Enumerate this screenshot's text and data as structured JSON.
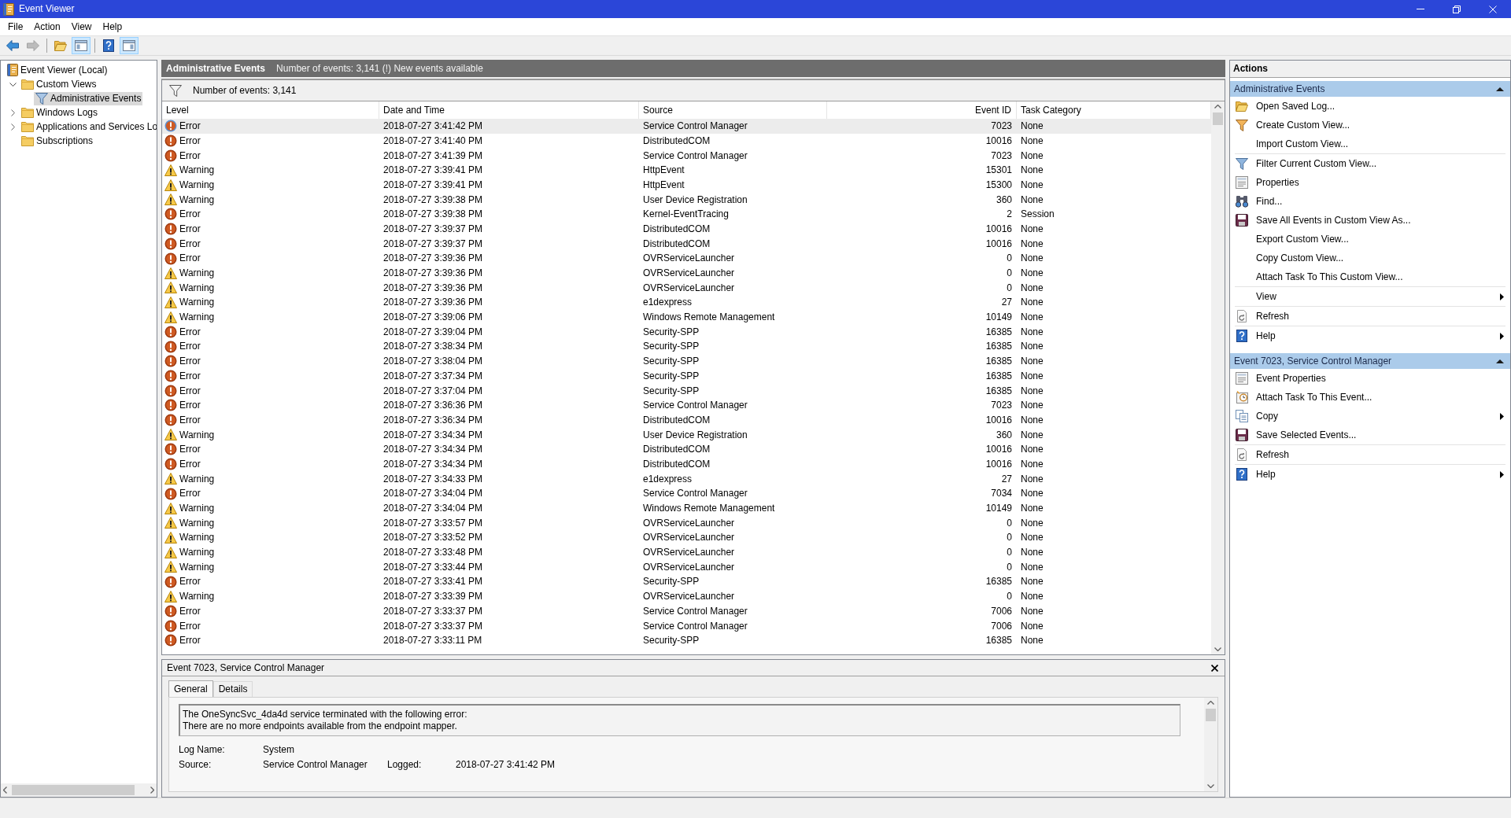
{
  "window": {
    "title": "Event Viewer"
  },
  "menu": [
    "File",
    "Action",
    "View",
    "Help"
  ],
  "toolbar": [
    [
      {
        "disabled": false,
        "pressed": false
      },
      {
        "disabled": true,
        "pressed": false
      }
    ],
    [
      {
        "disabled": false,
        "pressed": false
      },
      {
        "disabled": false,
        "pressed": true
      }
    ],
    [
      {
        "disabled": false,
        "pressed": false
      },
      {
        "disabled": false,
        "pressed": true
      }
    ]
  ],
  "tree": [
    {
      "label": "Event Viewer (Local)",
      "kind": "console",
      "selected": false,
      "children": [
        {
          "label": "Custom Views",
          "kind": "folder",
          "expanded": true,
          "selected": false,
          "children": [
            {
              "label": "Administrative Events",
              "kind": "view",
              "selected": true
            }
          ]
        },
        {
          "label": "Windows Logs",
          "kind": "folder",
          "expanded": false,
          "selected": false
        },
        {
          "label": "Applications and Services Lo",
          "kind": "folder",
          "expanded": false,
          "selected": false
        },
        {
          "label": "Subscriptions",
          "kind": "folder",
          "selected": false
        }
      ]
    }
  ],
  "view": {
    "title": "Administrative Events",
    "summary": "Number of events: 3,141 (!) New events available",
    "filter": "Number of events: 3,141"
  },
  "table": {
    "columns": [
      "Level",
      "Date and Time",
      "Source",
      "Event ID",
      "Task Category"
    ],
    "rows": [
      {
        "kind": "error",
        "level": "Error",
        "date": "2018-07-27 3:41:42 PM",
        "source": "Service Control Manager",
        "event_id": "7023",
        "task_category": "None",
        "selected": true
      },
      {
        "kind": "error",
        "level": "Error",
        "date": "2018-07-27 3:41:40 PM",
        "source": "DistributedCOM",
        "event_id": "10016",
        "task_category": "None",
        "selected": false
      },
      {
        "kind": "error",
        "level": "Error",
        "date": "2018-07-27 3:41:39 PM",
        "source": "Service Control Manager",
        "event_id": "7023",
        "task_category": "None",
        "selected": false
      },
      {
        "kind": "warning",
        "level": "Warning",
        "date": "2018-07-27 3:39:41 PM",
        "source": "HttpEvent",
        "event_id": "15301",
        "task_category": "None",
        "selected": false
      },
      {
        "kind": "warning",
        "level": "Warning",
        "date": "2018-07-27 3:39:41 PM",
        "source": "HttpEvent",
        "event_id": "15300",
        "task_category": "None",
        "selected": false
      },
      {
        "kind": "warning",
        "level": "Warning",
        "date": "2018-07-27 3:39:38 PM",
        "source": "User Device Registration",
        "event_id": "360",
        "task_category": "None",
        "selected": false
      },
      {
        "kind": "error",
        "level": "Error",
        "date": "2018-07-27 3:39:38 PM",
        "source": "Kernel-EventTracing",
        "event_id": "2",
        "task_category": "Session",
        "selected": false
      },
      {
        "kind": "error",
        "level": "Error",
        "date": "2018-07-27 3:39:37 PM",
        "source": "DistributedCOM",
        "event_id": "10016",
        "task_category": "None",
        "selected": false
      },
      {
        "kind": "error",
        "level": "Error",
        "date": "2018-07-27 3:39:37 PM",
        "source": "DistributedCOM",
        "event_id": "10016",
        "task_category": "None",
        "selected": false
      },
      {
        "kind": "error",
        "level": "Error",
        "date": "2018-07-27 3:39:36 PM",
        "source": "OVRServiceLauncher",
        "event_id": "0",
        "task_category": "None",
        "selected": false
      },
      {
        "kind": "warning",
        "level": "Warning",
        "date": "2018-07-27 3:39:36 PM",
        "source": "OVRServiceLauncher",
        "event_id": "0",
        "task_category": "None",
        "selected": false
      },
      {
        "kind": "warning",
        "level": "Warning",
        "date": "2018-07-27 3:39:36 PM",
        "source": "OVRServiceLauncher",
        "event_id": "0",
        "task_category": "None",
        "selected": false
      },
      {
        "kind": "warning",
        "level": "Warning",
        "date": "2018-07-27 3:39:36 PM",
        "source": "e1dexpress",
        "event_id": "27",
        "task_category": "None",
        "selected": false
      },
      {
        "kind": "warning",
        "level": "Warning",
        "date": "2018-07-27 3:39:06 PM",
        "source": "Windows Remote Management",
        "event_id": "10149",
        "task_category": "None",
        "selected": false
      },
      {
        "kind": "error",
        "level": "Error",
        "date": "2018-07-27 3:39:04 PM",
        "source": "Security-SPP",
        "event_id": "16385",
        "task_category": "None",
        "selected": false
      },
      {
        "kind": "error",
        "level": "Error",
        "date": "2018-07-27 3:38:34 PM",
        "source": "Security-SPP",
        "event_id": "16385",
        "task_category": "None",
        "selected": false
      },
      {
        "kind": "error",
        "level": "Error",
        "date": "2018-07-27 3:38:04 PM",
        "source": "Security-SPP",
        "event_id": "16385",
        "task_category": "None",
        "selected": false
      },
      {
        "kind": "error",
        "level": "Error",
        "date": "2018-07-27 3:37:34 PM",
        "source": "Security-SPP",
        "event_id": "16385",
        "task_category": "None",
        "selected": false
      },
      {
        "kind": "error",
        "level": "Error",
        "date": "2018-07-27 3:37:04 PM",
        "source": "Security-SPP",
        "event_id": "16385",
        "task_category": "None",
        "selected": false
      },
      {
        "kind": "error",
        "level": "Error",
        "date": "2018-07-27 3:36:36 PM",
        "source": "Service Control Manager",
        "event_id": "7023",
        "task_category": "None",
        "selected": false
      },
      {
        "kind": "error",
        "level": "Error",
        "date": "2018-07-27 3:36:34 PM",
        "source": "DistributedCOM",
        "event_id": "10016",
        "task_category": "None",
        "selected": false
      },
      {
        "kind": "warning",
        "level": "Warning",
        "date": "2018-07-27 3:34:34 PM",
        "source": "User Device Registration",
        "event_id": "360",
        "task_category": "None",
        "selected": false
      },
      {
        "kind": "error",
        "level": "Error",
        "date": "2018-07-27 3:34:34 PM",
        "source": "DistributedCOM",
        "event_id": "10016",
        "task_category": "None",
        "selected": false
      },
      {
        "kind": "error",
        "level": "Error",
        "date": "2018-07-27 3:34:34 PM",
        "source": "DistributedCOM",
        "event_id": "10016",
        "task_category": "None",
        "selected": false
      },
      {
        "kind": "warning",
        "level": "Warning",
        "date": "2018-07-27 3:34:33 PM",
        "source": "e1dexpress",
        "event_id": "27",
        "task_category": "None",
        "selected": false
      },
      {
        "kind": "error",
        "level": "Error",
        "date": "2018-07-27 3:34:04 PM",
        "source": "Service Control Manager",
        "event_id": "7034",
        "task_category": "None",
        "selected": false
      },
      {
        "kind": "warning",
        "level": "Warning",
        "date": "2018-07-27 3:34:04 PM",
        "source": "Windows Remote Management",
        "event_id": "10149",
        "task_category": "None",
        "selected": false
      },
      {
        "kind": "warning",
        "level": "Warning",
        "date": "2018-07-27 3:33:57 PM",
        "source": "OVRServiceLauncher",
        "event_id": "0",
        "task_category": "None",
        "selected": false
      },
      {
        "kind": "warning",
        "level": "Warning",
        "date": "2018-07-27 3:33:52 PM",
        "source": "OVRServiceLauncher",
        "event_id": "0",
        "task_category": "None",
        "selected": false
      },
      {
        "kind": "warning",
        "level": "Warning",
        "date": "2018-07-27 3:33:48 PM",
        "source": "OVRServiceLauncher",
        "event_id": "0",
        "task_category": "None",
        "selected": false
      },
      {
        "kind": "warning",
        "level": "Warning",
        "date": "2018-07-27 3:33:44 PM",
        "source": "OVRServiceLauncher",
        "event_id": "0",
        "task_category": "None",
        "selected": false
      },
      {
        "kind": "error",
        "level": "Error",
        "date": "2018-07-27 3:33:41 PM",
        "source": "Security-SPP",
        "event_id": "16385",
        "task_category": "None",
        "selected": false
      },
      {
        "kind": "warning",
        "level": "Warning",
        "date": "2018-07-27 3:33:39 PM",
        "source": "OVRServiceLauncher",
        "event_id": "0",
        "task_category": "None",
        "selected": false
      },
      {
        "kind": "error",
        "level": "Error",
        "date": "2018-07-27 3:33:37 PM",
        "source": "Service Control Manager",
        "event_id": "7006",
        "task_category": "None",
        "selected": false
      },
      {
        "kind": "error",
        "level": "Error",
        "date": "2018-07-27 3:33:37 PM",
        "source": "Service Control Manager",
        "event_id": "7006",
        "task_category": "None",
        "selected": false
      },
      {
        "kind": "error",
        "level": "Error",
        "date": "2018-07-27 3:33:11 PM",
        "source": "Security-SPP",
        "event_id": "16385",
        "task_category": "None",
        "selected": false
      }
    ]
  },
  "details": {
    "title": "Event 7023, Service Control Manager",
    "tabs": [
      {
        "label": "General",
        "selected": true
      },
      {
        "label": "Details",
        "selected": false
      }
    ],
    "message": "The OneSyncSvc_4da4d service terminated with the following error:\nThere are no more endpoints available from the endpoint mapper.",
    "fields": [
      [
        {
          "label": "Log Name:",
          "value": "System"
        }
      ],
      [
        {
          "label": "Source:",
          "value": "Service Control Manager"
        },
        {
          "label": "Logged:",
          "value": "2018-07-27 3:41:42 PM"
        }
      ]
    ]
  },
  "actions": {
    "title": "Actions",
    "sections": [
      {
        "title": "Administrative Events",
        "expanded": true,
        "groups": [
          [
            {
              "label": "Open Saved Log...",
              "submenu": false
            },
            {
              "label": "Create Custom View...",
              "submenu": false
            },
            {
              "label": "Import Custom View...",
              "submenu": false
            }
          ],
          [
            {
              "label": "Filter Current Custom View...",
              "submenu": false
            },
            {
              "label": "Properties",
              "submenu": false
            },
            {
              "label": "Find...",
              "submenu": false
            },
            {
              "label": "Save All Events in Custom View As...",
              "submenu": false
            },
            {
              "label": "Export Custom View...",
              "submenu": false
            },
            {
              "label": "Copy Custom View...",
              "submenu": false
            },
            {
              "label": "Attach Task To This Custom View...",
              "submenu": false
            }
          ],
          [
            {
              "label": "View",
              "submenu": true
            }
          ],
          [
            {
              "label": "Refresh",
              "submenu": false
            }
          ],
          [
            {
              "label": "Help",
              "submenu": true
            }
          ]
        ]
      },
      {
        "title": "Event 7023, Service Control Manager",
        "expanded": true,
        "groups": [
          [
            {
              "label": "Event Properties",
              "submenu": false
            },
            {
              "label": "Attach Task To This Event...",
              "submenu": false
            },
            {
              "label": "Copy",
              "submenu": true
            },
            {
              "label": "Save Selected Events...",
              "submenu": false
            }
          ],
          [
            {
              "label": "Refresh",
              "submenu": false
            }
          ],
          [
            {
              "label": "Help",
              "submenu": true
            }
          ]
        ]
      }
    ]
  }
}
